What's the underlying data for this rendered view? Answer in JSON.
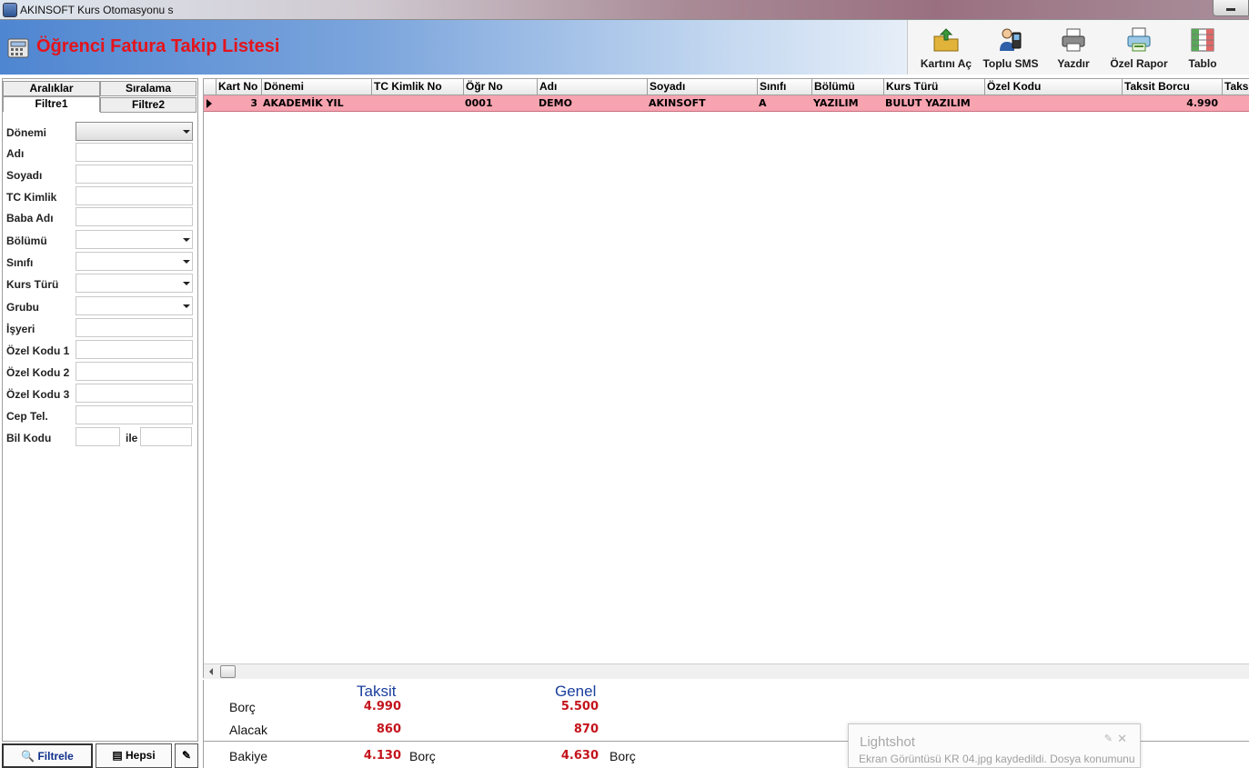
{
  "window": {
    "title": "AKINSOFT Kurs Otomasyonu s"
  },
  "header": {
    "title": "Öğrenci Fatura Takip Listesi"
  },
  "toolbar": [
    {
      "name": "open-card-button",
      "icon": "folder-arrow-icon",
      "label": "Kartını Aç"
    },
    {
      "name": "bulk-sms-button",
      "icon": "phone-user-icon",
      "label": "Toplu SMS"
    },
    {
      "name": "print-button",
      "icon": "printer-icon",
      "label": "Yazdır"
    },
    {
      "name": "custom-report-button",
      "icon": "report-printer-icon",
      "label": "Özel Rapor"
    },
    {
      "name": "table-button",
      "icon": "table-icon",
      "label": "Tablo"
    }
  ],
  "tabs": {
    "row1": [
      "Aralıklar",
      "Sıralama"
    ],
    "row2": [
      "Filtre1",
      "Filtre2"
    ]
  },
  "filters": [
    {
      "label": "Dönemi",
      "type": "select",
      "value": ""
    },
    {
      "label": "Adı",
      "type": "text",
      "value": ""
    },
    {
      "label": "Soyadı",
      "type": "text",
      "value": ""
    },
    {
      "label": "TC Kimlik",
      "type": "text",
      "value": ""
    },
    {
      "label": "Baba Adı",
      "type": "text",
      "value": ""
    },
    {
      "label": "Bölümü",
      "type": "select",
      "value": ""
    },
    {
      "label": "Sınıfı",
      "type": "select",
      "value": ""
    },
    {
      "label": "Kurs Türü",
      "type": "select",
      "value": ""
    },
    {
      "label": "Grubu",
      "type": "select",
      "value": ""
    },
    {
      "label": "İşyeri",
      "type": "text",
      "value": ""
    },
    {
      "label": "Özel Kodu 1",
      "type": "text",
      "value": ""
    },
    {
      "label": "Özel Kodu 2",
      "type": "text",
      "value": ""
    },
    {
      "label": "Özel Kodu 3",
      "type": "text",
      "value": ""
    },
    {
      "label": "Cep Tel.",
      "type": "text",
      "value": ""
    }
  ],
  "bil_kodu": {
    "label": "Bil Kodu",
    "between": "ile"
  },
  "bottom_buttons": {
    "filter": "Filtrele",
    "all": "Hepsi"
  },
  "grid": {
    "columns": [
      "Kart No",
      "Dönemi",
      "TC Kimlik No",
      "Öğr No",
      "Adı",
      "Soyadı",
      "Sınıfı",
      "Bölümü",
      "Kurs Türü",
      "Özel Kodu",
      "Taksit Borcu",
      "Taks"
    ],
    "rows": [
      [
        "3",
        "AKADEMİK YIL",
        "",
        "0001",
        "DEMO",
        "AKINSOFT",
        "A",
        "YAZILIM",
        "BULUT YAZILIM",
        "",
        "4.990",
        ""
      ]
    ]
  },
  "summary": {
    "head_taksit": "Taksit",
    "head_genel": "Genel",
    "borc_label": "Borç",
    "alacak_label": "Alacak",
    "bakiye_label": "Bakiye",
    "taksit_borc": "4.990",
    "taksit_alacak": "860",
    "taksit_bakiye": "4.130",
    "taksit_bakiye_type": "Borç",
    "genel_borc": "5.500",
    "genel_alacak": "870",
    "genel_bakiye": "4.630",
    "genel_bakiye_type": "Borç"
  },
  "notification": {
    "title": "Lightshot",
    "text": "Ekran Görüntüsü KR 04.jpg kaydedildi. Dosya konumunu"
  }
}
